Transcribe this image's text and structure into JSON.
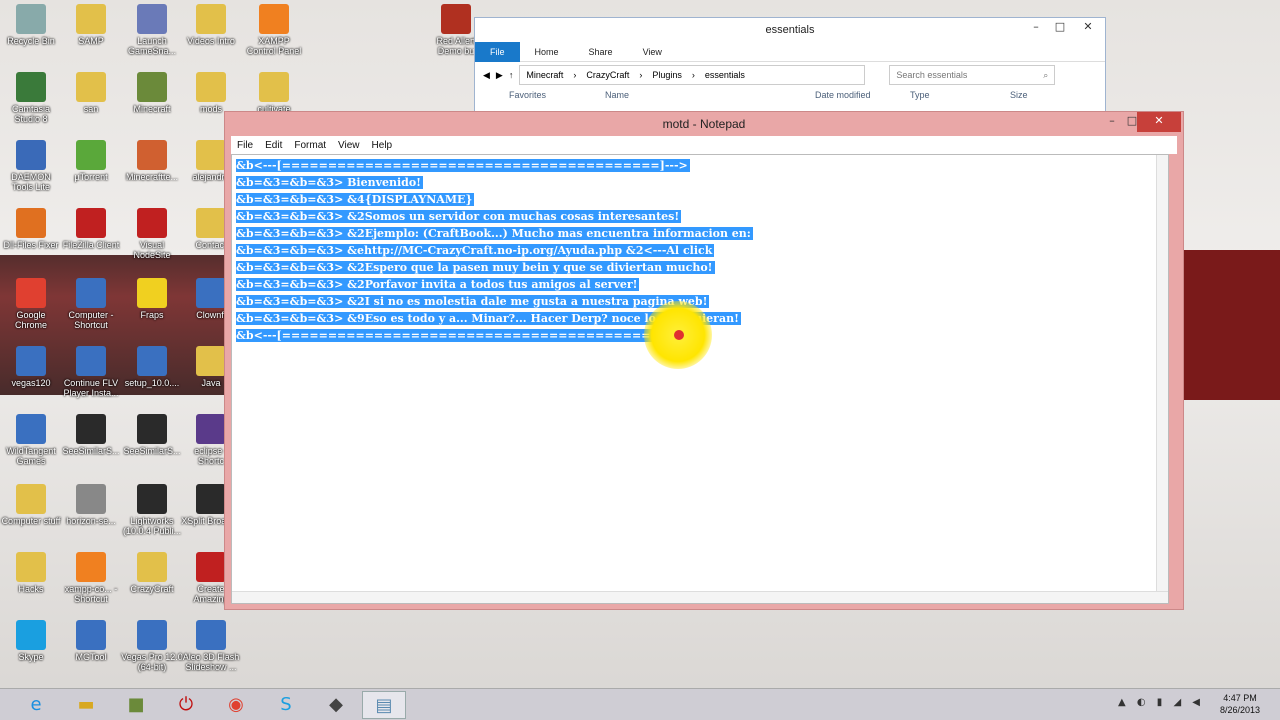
{
  "desktop_icons": [
    {
      "label": "Recycle Bin",
      "color": "#8aa"
    },
    {
      "label": "SAMP",
      "color": "#e2c04a"
    },
    {
      "label": "Launch GameSna...",
      "color": "#6a7ab8"
    },
    {
      "label": "Videos Intro",
      "color": "#e2c04a"
    },
    {
      "label": "XAMPP Control Panel",
      "color": "#f08020"
    },
    {
      "label": "Red Allert Demo bu",
      "color": "#b03020"
    },
    {
      "label": "Camtasia Studio 8",
      "color": "#3a7a3a"
    },
    {
      "label": "san",
      "color": "#e2c04a"
    },
    {
      "label": "Minecraft",
      "color": "#6b8a3a"
    },
    {
      "label": "mods",
      "color": "#e2c04a"
    },
    {
      "label": "cultivate",
      "color": "#e2c04a"
    },
    {
      "label": "DAEMON Tools Lite",
      "color": "#3a6ab8"
    },
    {
      "label": "µTorrent",
      "color": "#5aa83a"
    },
    {
      "label": "Minecraftte...",
      "color": "#d06030"
    },
    {
      "label": "alejandro",
      "color": "#e2c04a"
    },
    {
      "label": "Dll-Files Fixer",
      "color": "#e07020"
    },
    {
      "label": "FileZilla Client",
      "color": "#c02020"
    },
    {
      "label": "Visual NodeSite",
      "color": "#c02020"
    },
    {
      "label": "Contact",
      "color": "#e2c04a"
    },
    {
      "label": "Google Chrome",
      "color": "#e04030"
    },
    {
      "label": "Computer - Shortcut",
      "color": "#3a70c0"
    },
    {
      "label": "Fraps",
      "color": "#f0d020"
    },
    {
      "label": "Clownfi",
      "color": "#3a70c0"
    },
    {
      "label": "vegas120",
      "color": "#3a70c0"
    },
    {
      "label": "Continue FLV Player Insta...",
      "color": "#3a70c0"
    },
    {
      "label": "setup_10.0....",
      "color": "#3a70c0"
    },
    {
      "label": "Java",
      "color": "#e2c04a"
    },
    {
      "label": "WildTangent Games",
      "color": "#3a70c0"
    },
    {
      "label": "SeeSimilarS...",
      "color": "#2a2a2a"
    },
    {
      "label": "SeeSimilarS...",
      "color": "#2a2a2a"
    },
    {
      "label": "eclipse - Shortc",
      "color": "#5a3a8a"
    },
    {
      "label": "Computer stuff",
      "color": "#e2c04a"
    },
    {
      "label": "horizon-se...",
      "color": "#888888"
    },
    {
      "label": "Lightworks (10.0.4 Publi...",
      "color": "#2a2a2a"
    },
    {
      "label": "XSplit Broadca",
      "color": "#2a2a2a"
    },
    {
      "label": "Hacks",
      "color": "#e2c04a"
    },
    {
      "label": "xampp-co... - Shortcut",
      "color": "#f08020"
    },
    {
      "label": "CrazyCraft",
      "color": "#e2c04a"
    },
    {
      "label": "Create Amazing",
      "color": "#c02020"
    },
    {
      "label": "Skype",
      "color": "#1a9fe0"
    },
    {
      "label": "MGTool",
      "color": "#3a70c0"
    },
    {
      "label": "Vegas Pro 12.0 (64-bit)",
      "color": "#3a70c0"
    },
    {
      "label": "Aleo 3D Flash Slideshow ...",
      "color": "#3a70c0"
    }
  ],
  "explorer": {
    "title": "essentials",
    "ribbon_tabs": [
      "File",
      "Home",
      "Share",
      "View"
    ],
    "path": [
      "Minecraft",
      "CrazyCraft",
      "Plugins",
      "essentials"
    ],
    "search_placeholder": "Search essentials",
    "columns": [
      "Name",
      "Date modified",
      "Type",
      "Size"
    ],
    "nav_item": "Favorites"
  },
  "notepad": {
    "title": "motd - Notepad",
    "menu": [
      "File",
      "Edit",
      "Format",
      "View",
      "Help"
    ],
    "lines": [
      "&b<---[=========================================]--->",
      "&b=&3=&b=&3> Bienvenido!",
      "&b=&3=&b=&3> &4{DISPLAYNAME}",
      "&b=&3=&b=&3> &2Somos un servidor con muchas cosas interesantes!",
      "&b=&3=&b=&3> &2Ejemplo: (CraftBook...) Mucho mas encuentra informacion en:",
      "&b=&3=&b=&3> &ehttp://MC-CrazyCraft.no-ip.org/Ayuda.php   &2<---Al click",
      "&b=&3=&b=&3> &2Espero que la pasen muy bein y que se diviertan mucho!",
      "&b=&3=&b=&3> &2Porfavor invita a todos tus amigos al server!",
      "&b=&3=&b=&3> &2I si no es molestia dale me gusta a nuestra pagina web!",
      "&b=&3=&b=&3> &9Eso es todo y a... Minar?... Hacer Derp? noce lo que quieran!",
      "&b<---[=========================================]--->"
    ]
  },
  "taskbar": {
    "apps": [
      "Internet Explorer",
      "File Explorer",
      "Minecraft",
      "Power",
      "Google Chrome",
      "Skype",
      "Minecraft Launcher",
      "Notepad"
    ],
    "time": "4:47 PM",
    "date": "8/26/2013"
  },
  "colors": {
    "selection": "#3399ff",
    "accent": "#1979ca",
    "close": "#c7403a"
  }
}
